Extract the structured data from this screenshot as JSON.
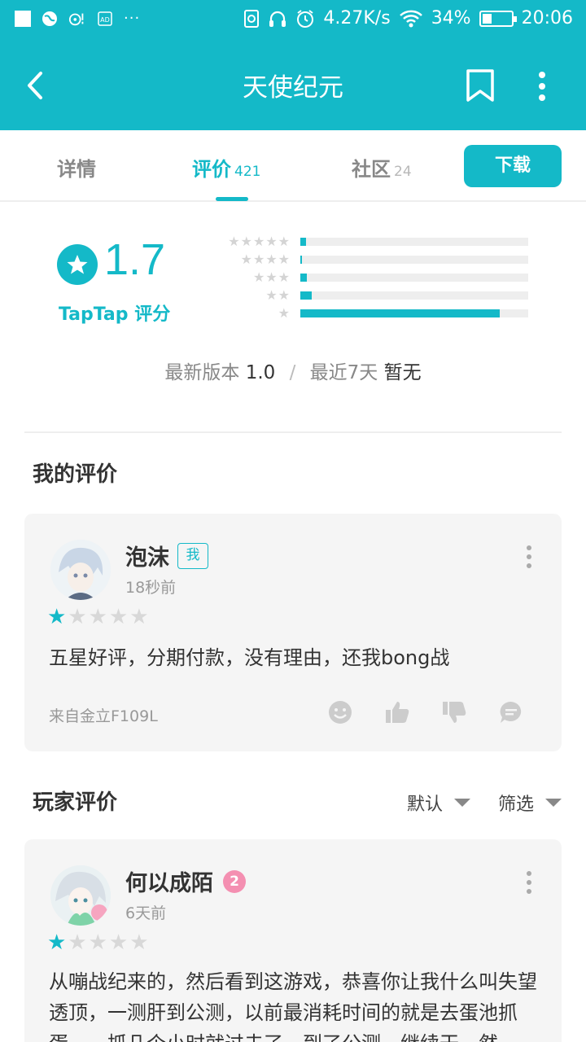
{
  "status_bar": {
    "net_speed": "4.27K/s",
    "battery_percent": "34%",
    "battery_level": 0.34,
    "time": "20:06",
    "left_icons": [
      "square-icon",
      "globe-icon",
      "link-icon",
      "ad-icon",
      "more-dots-icon"
    ],
    "right_icons": [
      "sim-icon",
      "headset-icon",
      "alarm-icon",
      "wifi-icon",
      "battery-icon"
    ]
  },
  "app_bar": {
    "title": "天使纪元"
  },
  "tabs": [
    {
      "label": "详情",
      "count": ""
    },
    {
      "label": "评价",
      "count": "421"
    },
    {
      "label": "社区",
      "count": "24"
    }
  ],
  "download_label": "下载",
  "rating": {
    "score": "1.7",
    "source_label": "TapTap 评分",
    "distribution": [
      {
        "stars": 5,
        "fraction": 0.025
      },
      {
        "stars": 4,
        "fraction": 0.008
      },
      {
        "stars": 3,
        "fraction": 0.03
      },
      {
        "stars": 2,
        "fraction": 0.05
      },
      {
        "stars": 1,
        "fraction": 0.875
      }
    ]
  },
  "version": {
    "label": "最新版本",
    "value": "1.0",
    "recent_label": "最近7天",
    "recent_value": "暂无"
  },
  "my_review_title": "我的评价",
  "my_review": {
    "username": "泡沫",
    "badge": "我",
    "time": "18秒前",
    "stars": 1,
    "text": "五星好评，分期付款，没有理由，还我bong战",
    "device": "来自金立F109L"
  },
  "player_reviews_title": "玩家评价",
  "sort": {
    "default_label": "默认",
    "filter_label": "筛选"
  },
  "player_reviews": [
    {
      "username": "何以成陌",
      "level": "2",
      "time": "6天前",
      "stars": 1,
      "text": "从嘣战纪来的，然后看到这游戏，恭喜你让我什么叫失望透顶，一测肝到公测，以前最消耗时间的就是去蛋池抓蛋，一抓几个小时就过去了，到了公测，继续干，然"
    }
  ]
}
